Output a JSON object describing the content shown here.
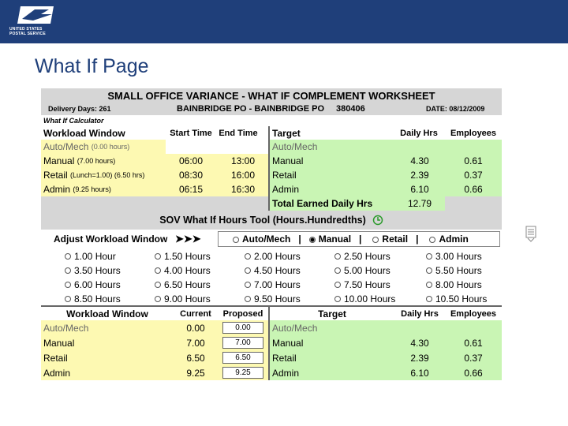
{
  "header": {
    "logo_text_line1": "UNITED STATES",
    "logo_text_line2": "POSTAL SERVICE",
    "brand_color": "#1f3f7a"
  },
  "page_title": "What If Page",
  "worksheet": {
    "title": "SMALL OFFICE VARIANCE - WHAT IF COMPLEMENT WORKSHEET",
    "delivery_days": "Delivery Days: 261",
    "office": "BAINBRIDGE PO - BAINBRIDGE PO",
    "office_id": "380406",
    "date": "DATE: 08/12/2009",
    "calculator_label": "What If Calculator",
    "workload_header": {
      "window": "Workload Window",
      "start": "Start Time",
      "end": "End Time",
      "target": "Target",
      "daily_hrs": "Daily Hrs",
      "employees": "Employees"
    },
    "workload_rows": [
      {
        "name": "Auto/Mech",
        "detail": "(0.00 hours)",
        "start": "",
        "end": "",
        "target": "Auto/Mech",
        "daily": "",
        "emp": ""
      },
      {
        "name": "Manual",
        "detail": "(7.00 hours)",
        "start": "06:00",
        "end": "13:00",
        "target": "Manual",
        "daily": "4.30",
        "emp": "0.61"
      },
      {
        "name": "Retail",
        "detail": "(Lunch=1.00) (6.50 hrs)",
        "start": "08:30",
        "end": "16:00",
        "target": "Retail",
        "daily": "2.39",
        "emp": "0.37"
      },
      {
        "name": "Admin",
        "detail": "(9.25 hours)",
        "start": "06:15",
        "end": "16:30",
        "target": "Admin",
        "daily": "6.10",
        "emp": "0.66"
      }
    ],
    "total_label": "Total Earned Daily Hrs",
    "total_value": "12.79",
    "sov_tool_title": "SOV What If Hours Tool (Hours.Hundredths)",
    "adjust_label": "Adjust Workload Window",
    "window_options": [
      "Auto/Mech",
      "Manual",
      "Retail",
      "Admin"
    ],
    "selected_window": "Manual",
    "separator": "|",
    "hour_options": [
      "1.00 Hour",
      "1.50 Hours",
      "2.00 Hours",
      "2.50 Hours",
      "3.00 Hours",
      "3.50 Hours",
      "4.00 Hours",
      "4.50 Hours",
      "5.00 Hours",
      "5.50 Hours",
      "6.00 Hours",
      "6.50 Hours",
      "7.00 Hours",
      "7.50 Hours",
      "8.00 Hours",
      "8.50 Hours",
      "9.00 Hours",
      "9.50 Hours",
      "10.00 Hours",
      "10.50 Hours"
    ],
    "proposed_header": {
      "window": "Workload Window",
      "current": "Current",
      "proposed": "Proposed",
      "target": "Target",
      "daily_hrs": "Daily Hrs",
      "employees": "Employees"
    },
    "proposed_rows": [
      {
        "name": "Auto/Mech",
        "current": "0.00",
        "proposed": "0.00",
        "target": "Auto/Mech",
        "daily": "",
        "emp": ""
      },
      {
        "name": "Manual",
        "current": "7.00",
        "proposed": "7.00",
        "target": "Manual",
        "daily": "4.30",
        "emp": "0.61"
      },
      {
        "name": "Retail",
        "current": "6.50",
        "proposed": "6.50",
        "target": "Retail",
        "daily": "2.39",
        "emp": "0.37"
      },
      {
        "name": "Admin",
        "current": "9.25",
        "proposed": "9.25",
        "target": "Admin",
        "daily": "6.10",
        "emp": "0.66"
      }
    ]
  }
}
